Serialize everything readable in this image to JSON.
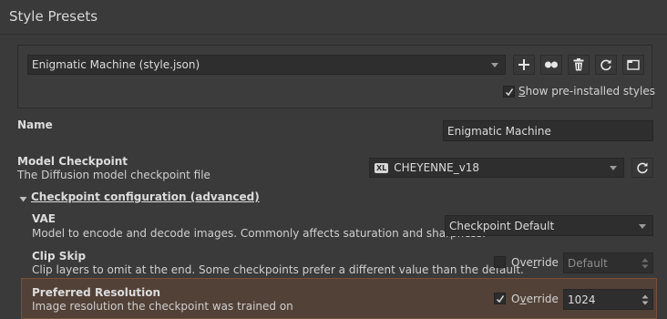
{
  "header": {
    "title": "Style Presets"
  },
  "preset": {
    "selected": "Enigmatic Machine (style.json)",
    "show_preinstalled": {
      "label_accel": "S",
      "label_rest": "how pre-installed styles",
      "checked": true
    }
  },
  "toolbar_icons": [
    "add-icon",
    "duplicate-icon",
    "delete-icon",
    "refresh-icon",
    "folder-icon"
  ],
  "name": {
    "label": "Name",
    "value": "Enigmatic Machine"
  },
  "model_checkpoint": {
    "label": "Model Checkpoint",
    "description": "The Diffusion model checkpoint file",
    "badge": "XL",
    "selected": "CHEYENNE_v18"
  },
  "advanced": {
    "label": "Checkpoint configuration (advanced)",
    "expanded": true
  },
  "vae": {
    "label": "VAE",
    "description": "Model to encode and decode images. Commonly affects saturation and sharpness.",
    "selected": "Checkpoint Default"
  },
  "clip_skip": {
    "label": "Clip Skip",
    "description": "Clip layers to omit at the end. Some checkpoints prefer a different value than the default.",
    "override_accel": "r",
    "override_pre": "Ove",
    "override_post": "ride",
    "override_checked": false,
    "value": "Default"
  },
  "preferred_resolution": {
    "label": "Preferred Resolution",
    "description": "Image resolution the checkpoint was trained on",
    "override_pre": "O",
    "override_accel": "v",
    "override_post": "erride",
    "override_checked": true,
    "value": "1024"
  },
  "colors": {
    "background": "#3a3a3a",
    "highlight_border": "#7c5132",
    "highlight_fill": "#524137"
  }
}
